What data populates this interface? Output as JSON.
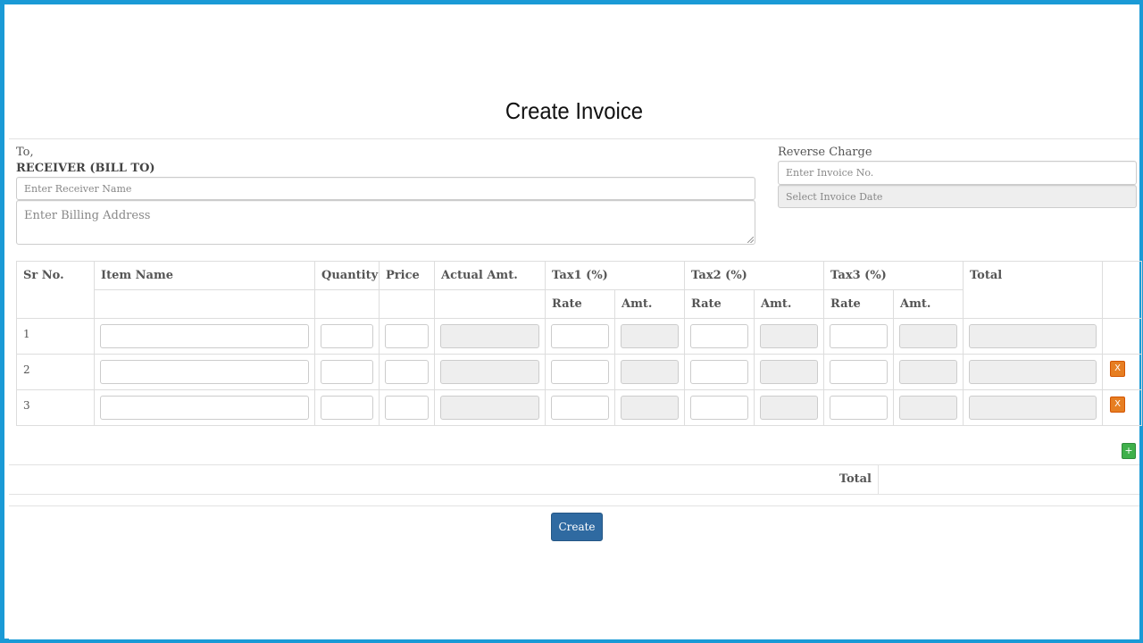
{
  "page": {
    "title": "Create Invoice"
  },
  "receiver": {
    "to_label": "To,",
    "bill_to_label": "RECEIVER (BILL TO)",
    "name_placeholder": "Enter Receiver Name",
    "address_placeholder": "Enter Billing Address"
  },
  "invoice": {
    "reverse_charge_label": "Reverse Charge",
    "number_placeholder": "Enter Invoice No.",
    "date_placeholder": "Select Invoice Date"
  },
  "table": {
    "headers": {
      "sr_no": "Sr No.",
      "item_name": "Item Name",
      "quantity": "Quantity",
      "price": "Price",
      "actual_amt": "Actual Amt.",
      "tax1": "Tax1 (%)",
      "tax2": "Tax2 (%)",
      "tax3": "Tax3 (%)",
      "total": "Total",
      "rate": "Rate",
      "amt": "Amt."
    },
    "rows": [
      {
        "sr": "1"
      },
      {
        "sr": "2",
        "delete_label": "X"
      },
      {
        "sr": "3",
        "delete_label": "X"
      }
    ]
  },
  "add_row_label": "+",
  "footer": {
    "total_label": "Total"
  },
  "create_button": "Create",
  "colors": {
    "frame_border": "#1a9ad6",
    "delete_button": "#e67e22",
    "add_button": "#3fb04b",
    "create_button": "#2f6aa1"
  }
}
